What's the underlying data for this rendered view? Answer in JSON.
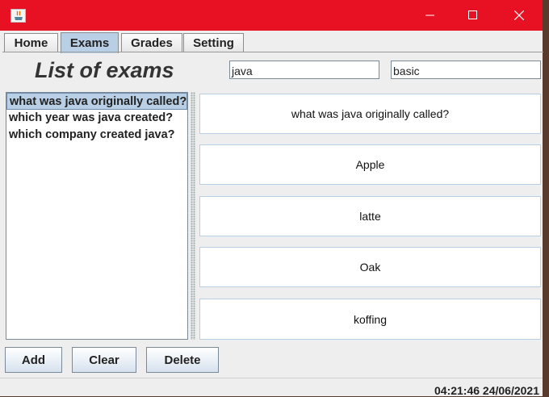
{
  "window": {
    "title": ""
  },
  "tabs": [
    "Home",
    "Exams",
    "Grades",
    "Setting"
  ],
  "page_title": "List of exams",
  "filters": {
    "subject": "java",
    "level": "basic"
  },
  "questions": [
    "what was java originally called?",
    "which year was java created?",
    "which company created java?"
  ],
  "selected_question": "what was java originally called?",
  "answers": [
    "Apple",
    "latte",
    "Oak",
    "koffing"
  ],
  "buttons": {
    "add": "Add",
    "clear": "Clear",
    "delete": "Delete"
  },
  "status": {
    "clock": "04:21:46 24/06/2021"
  },
  "colors": {
    "titlebar": "#e81123",
    "accent": "#b8cfe5"
  },
  "icons": {
    "app": "java-cup-icon",
    "minimize": "minimize-icon",
    "maximize": "maximize-icon",
    "close": "close-icon"
  }
}
